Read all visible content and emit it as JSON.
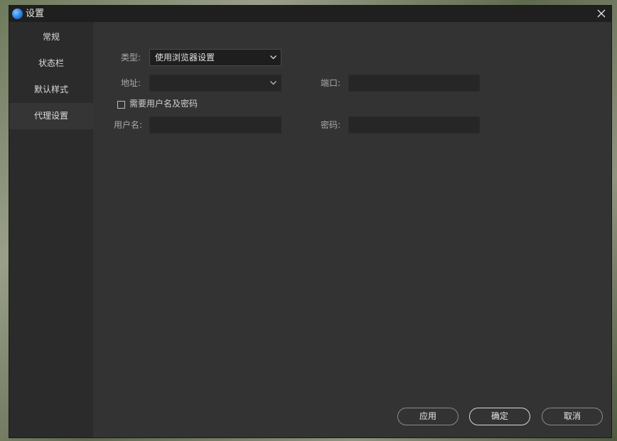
{
  "window": {
    "title": "设置"
  },
  "sidebar": {
    "items": [
      {
        "label": "常规"
      },
      {
        "label": "状态栏"
      },
      {
        "label": "默认样式"
      },
      {
        "label": "代理设置"
      }
    ],
    "active_index": 3
  },
  "proxy": {
    "type_label": "类型:",
    "type_value": "使用浏览器设置",
    "address_label": "地址:",
    "address_value": "",
    "port_label": "端口:",
    "port_value": "",
    "auth_checkbox_label": "需要用户名及密码",
    "auth_checked": false,
    "username_label": "用户名:",
    "username_value": "",
    "password_label": "密码:",
    "password_value": ""
  },
  "footer": {
    "apply_label": "应用",
    "ok_label": "确定",
    "cancel_label": "取消"
  },
  "icons": {
    "app": "app-logo-icon",
    "close": "close-icon",
    "dropdown": "chevron-down-icon",
    "checkbox": "checkbox-icon"
  },
  "colors": {
    "window_bg": "#2f2f2f",
    "titlebar_bg": "#1f1f1f",
    "sidebar_bg": "#2b2b2b",
    "content_bg": "#333333",
    "field_bg": "#262626",
    "text": "#dcdcdc"
  }
}
